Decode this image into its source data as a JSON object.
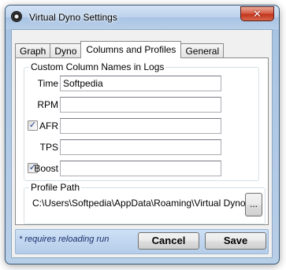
{
  "window": {
    "title": "Virtual Dyno Settings",
    "close_label": "✕"
  },
  "tabs": [
    {
      "label": "Graph",
      "active": false
    },
    {
      "label": "Dyno",
      "active": false
    },
    {
      "label": "Columns and Profiles",
      "active": true
    },
    {
      "label": "General",
      "active": false
    }
  ],
  "columns_group": {
    "legend": "Custom Column Names in Logs",
    "rows": [
      {
        "label": "Time",
        "value": "Softpedia",
        "has_checkbox": false
      },
      {
        "label": "RPM",
        "value": "",
        "has_checkbox": false
      },
      {
        "label": "AFR",
        "value": "",
        "has_checkbox": true,
        "checked": true
      },
      {
        "label": "TPS",
        "value": "",
        "has_checkbox": false
      },
      {
        "label": "Boost",
        "value": "",
        "has_checkbox": true,
        "checked": true
      }
    ]
  },
  "profile_group": {
    "legend": "Profile Path",
    "path": "C:\\Users\\Softpedia\\AppData\\Roaming\\Virtual Dyno",
    "browse_label": "..."
  },
  "footer": {
    "note": "* requires reloading run",
    "cancel_label": "Cancel",
    "save_label": "Save"
  },
  "check_mark": "✓"
}
